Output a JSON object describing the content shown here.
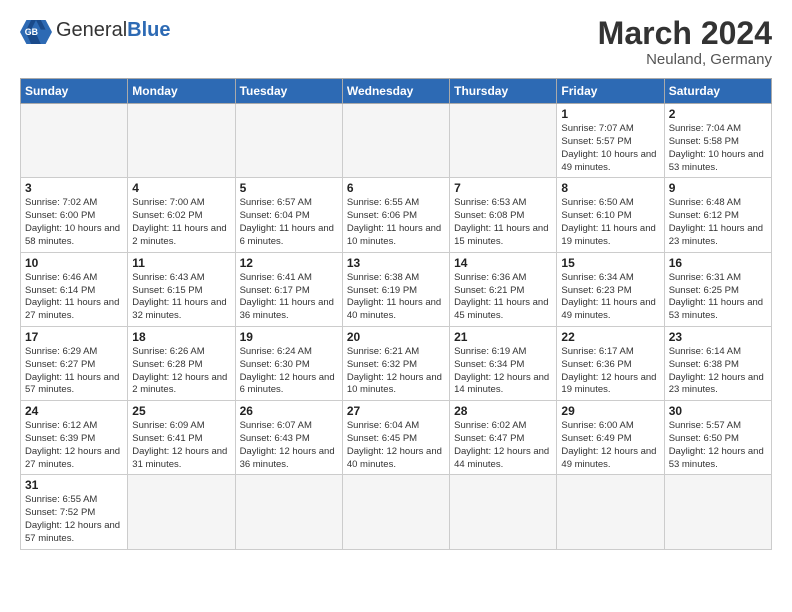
{
  "header": {
    "logo_general": "General",
    "logo_blue": "Blue",
    "title": "March 2024",
    "subtitle": "Neuland, Germany"
  },
  "weekdays": [
    "Sunday",
    "Monday",
    "Tuesday",
    "Wednesday",
    "Thursday",
    "Friday",
    "Saturday"
  ],
  "weeks": [
    [
      {
        "day": "",
        "info": "",
        "empty": true
      },
      {
        "day": "",
        "info": "",
        "empty": true
      },
      {
        "day": "",
        "info": "",
        "empty": true
      },
      {
        "day": "",
        "info": "",
        "empty": true
      },
      {
        "day": "",
        "info": "",
        "empty": true
      },
      {
        "day": "1",
        "info": "Sunrise: 7:07 AM\nSunset: 5:57 PM\nDaylight: 10 hours\nand 49 minutes."
      },
      {
        "day": "2",
        "info": "Sunrise: 7:04 AM\nSunset: 5:58 PM\nDaylight: 10 hours\nand 53 minutes."
      }
    ],
    [
      {
        "day": "3",
        "info": "Sunrise: 7:02 AM\nSunset: 6:00 PM\nDaylight: 10 hours\nand 58 minutes."
      },
      {
        "day": "4",
        "info": "Sunrise: 7:00 AM\nSunset: 6:02 PM\nDaylight: 11 hours\nand 2 minutes."
      },
      {
        "day": "5",
        "info": "Sunrise: 6:57 AM\nSunset: 6:04 PM\nDaylight: 11 hours\nand 6 minutes."
      },
      {
        "day": "6",
        "info": "Sunrise: 6:55 AM\nSunset: 6:06 PM\nDaylight: 11 hours\nand 10 minutes."
      },
      {
        "day": "7",
        "info": "Sunrise: 6:53 AM\nSunset: 6:08 PM\nDaylight: 11 hours\nand 15 minutes."
      },
      {
        "day": "8",
        "info": "Sunrise: 6:50 AM\nSunset: 6:10 PM\nDaylight: 11 hours\nand 19 minutes."
      },
      {
        "day": "9",
        "info": "Sunrise: 6:48 AM\nSunset: 6:12 PM\nDaylight: 11 hours\nand 23 minutes."
      }
    ],
    [
      {
        "day": "10",
        "info": "Sunrise: 6:46 AM\nSunset: 6:14 PM\nDaylight: 11 hours\nand 27 minutes."
      },
      {
        "day": "11",
        "info": "Sunrise: 6:43 AM\nSunset: 6:15 PM\nDaylight: 11 hours\nand 32 minutes."
      },
      {
        "day": "12",
        "info": "Sunrise: 6:41 AM\nSunset: 6:17 PM\nDaylight: 11 hours\nand 36 minutes."
      },
      {
        "day": "13",
        "info": "Sunrise: 6:38 AM\nSunset: 6:19 PM\nDaylight: 11 hours\nand 40 minutes."
      },
      {
        "day": "14",
        "info": "Sunrise: 6:36 AM\nSunset: 6:21 PM\nDaylight: 11 hours\nand 45 minutes."
      },
      {
        "day": "15",
        "info": "Sunrise: 6:34 AM\nSunset: 6:23 PM\nDaylight: 11 hours\nand 49 minutes."
      },
      {
        "day": "16",
        "info": "Sunrise: 6:31 AM\nSunset: 6:25 PM\nDaylight: 11 hours\nand 53 minutes."
      }
    ],
    [
      {
        "day": "17",
        "info": "Sunrise: 6:29 AM\nSunset: 6:27 PM\nDaylight: 11 hours\nand 57 minutes."
      },
      {
        "day": "18",
        "info": "Sunrise: 6:26 AM\nSunset: 6:28 PM\nDaylight: 12 hours\nand 2 minutes."
      },
      {
        "day": "19",
        "info": "Sunrise: 6:24 AM\nSunset: 6:30 PM\nDaylight: 12 hours\nand 6 minutes."
      },
      {
        "day": "20",
        "info": "Sunrise: 6:21 AM\nSunset: 6:32 PM\nDaylight: 12 hours\nand 10 minutes."
      },
      {
        "day": "21",
        "info": "Sunrise: 6:19 AM\nSunset: 6:34 PM\nDaylight: 12 hours\nand 14 minutes."
      },
      {
        "day": "22",
        "info": "Sunrise: 6:17 AM\nSunset: 6:36 PM\nDaylight: 12 hours\nand 19 minutes."
      },
      {
        "day": "23",
        "info": "Sunrise: 6:14 AM\nSunset: 6:38 PM\nDaylight: 12 hours\nand 23 minutes."
      }
    ],
    [
      {
        "day": "24",
        "info": "Sunrise: 6:12 AM\nSunset: 6:39 PM\nDaylight: 12 hours\nand 27 minutes."
      },
      {
        "day": "25",
        "info": "Sunrise: 6:09 AM\nSunset: 6:41 PM\nDaylight: 12 hours\nand 31 minutes."
      },
      {
        "day": "26",
        "info": "Sunrise: 6:07 AM\nSunset: 6:43 PM\nDaylight: 12 hours\nand 36 minutes."
      },
      {
        "day": "27",
        "info": "Sunrise: 6:04 AM\nSunset: 6:45 PM\nDaylight: 12 hours\nand 40 minutes."
      },
      {
        "day": "28",
        "info": "Sunrise: 6:02 AM\nSunset: 6:47 PM\nDaylight: 12 hours\nand 44 minutes."
      },
      {
        "day": "29",
        "info": "Sunrise: 6:00 AM\nSunset: 6:49 PM\nDaylight: 12 hours\nand 49 minutes."
      },
      {
        "day": "30",
        "info": "Sunrise: 5:57 AM\nSunset: 6:50 PM\nDaylight: 12 hours\nand 53 minutes."
      }
    ],
    [
      {
        "day": "31",
        "info": "Sunrise: 6:55 AM\nSunset: 7:52 PM\nDaylight: 12 hours\nand 57 minutes."
      },
      {
        "day": "",
        "info": "",
        "empty": true
      },
      {
        "day": "",
        "info": "",
        "empty": true
      },
      {
        "day": "",
        "info": "",
        "empty": true
      },
      {
        "day": "",
        "info": "",
        "empty": true
      },
      {
        "day": "",
        "info": "",
        "empty": true
      },
      {
        "day": "",
        "info": "",
        "empty": true
      }
    ]
  ]
}
